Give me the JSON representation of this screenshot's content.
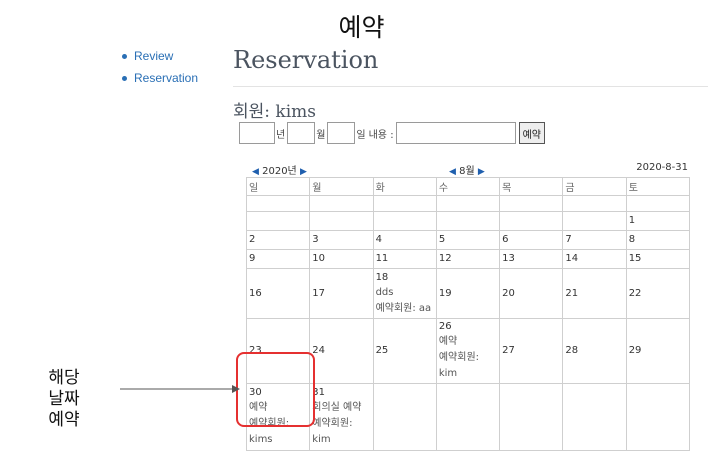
{
  "page_heading": "예약",
  "nav": {
    "items": [
      {
        "label": "Review"
      },
      {
        "label": "Reservation"
      }
    ]
  },
  "main": {
    "title": "Reservation",
    "member_line": "회원: kims"
  },
  "form": {
    "year_unit": "년",
    "month_unit": "월",
    "day_unit": "일",
    "content_label": "내용 :",
    "year_value": "",
    "month_value": "",
    "day_value": "",
    "content_value": "",
    "submit_label": "예약"
  },
  "calendar": {
    "year_label": "2020년",
    "month_label": "8월",
    "today": "2020-8-31",
    "weekdays": [
      "일",
      "월",
      "화",
      "수",
      "목",
      "금",
      "토"
    ],
    "days": {
      "d1": "1",
      "d2": "2",
      "d3": "3",
      "d4": "4",
      "d5": "5",
      "d6": "6",
      "d7": "7",
      "d8": "8",
      "d9": "9",
      "d10": "10",
      "d11": "11",
      "d12": "12",
      "d13": "13",
      "d14": "14",
      "d15": "15",
      "d16": "16",
      "d17": "17",
      "d18": "18",
      "d19": "19",
      "d20": "20",
      "d21": "21",
      "d22": "22",
      "d23": "23",
      "d24": "24",
      "d25": "25",
      "d26": "26",
      "d27": "27",
      "d28": "28",
      "d29": "29",
      "d30": "30",
      "d31": "31"
    },
    "reservations": {
      "d18": {
        "content": "dds",
        "member": "예약회원: aa"
      },
      "d26": {
        "content": "예약",
        "member": "예약회원: kim"
      },
      "d30": {
        "content": "예약",
        "member": "예약회원: kims"
      },
      "d31": {
        "content": "회의실 예약",
        "member": "예약회원: kim"
      }
    }
  },
  "annotation": {
    "text": "해당 날짜 예약"
  },
  "colors": {
    "link": "#2a6fb5",
    "highlight": "#e53030",
    "nav_arrow": "#1f5fae"
  }
}
